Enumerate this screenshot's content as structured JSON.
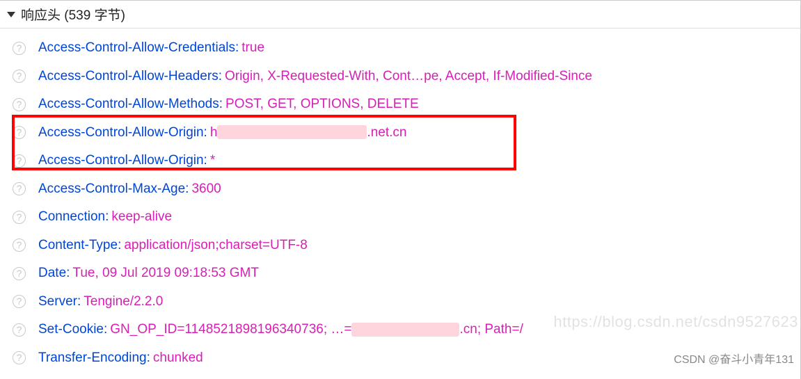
{
  "section": {
    "title": "响应头 (539 字节)"
  },
  "headers": [
    {
      "name": "Access-Control-Allow-Credentials:",
      "value": "true"
    },
    {
      "name": "Access-Control-Allow-Headers:",
      "value": "Origin, X-Requested-With, Cont…pe, Accept, If-Modified-Since"
    },
    {
      "name": "Access-Control-Allow-Methods:",
      "value": "POST, GET, OPTIONS, DELETE"
    },
    {
      "name": "Access-Control-Allow-Origin:",
      "value_prefix": "h",
      "value_suffix": ".net.cn",
      "redacted": true,
      "redact_width": 215
    },
    {
      "name": "Access-Control-Allow-Origin:",
      "value": "*"
    },
    {
      "name": "Access-Control-Max-Age:",
      "value": "3600"
    },
    {
      "name": "Connection:",
      "value": "keep-alive"
    },
    {
      "name": "Content-Type:",
      "value": "application/json;charset=UTF-8"
    },
    {
      "name": "Date:",
      "value": "Tue, 09 Jul 2019 09:18:53 GMT"
    },
    {
      "name": "Server:",
      "value": "Tengine/2.2.0"
    },
    {
      "name": "Set-Cookie:",
      "value_prefix": "GN_OP_ID=1148521898196340736; …=",
      "value_suffix": ".cn; Path=/",
      "redacted": true,
      "redact_width": 155
    },
    {
      "name": "Transfer-Encoding:",
      "value": "chunked"
    }
  ],
  "watermark": "https://blog.csdn.net/csdn9527623",
  "attribution": "CSDN @奋斗小青年131"
}
